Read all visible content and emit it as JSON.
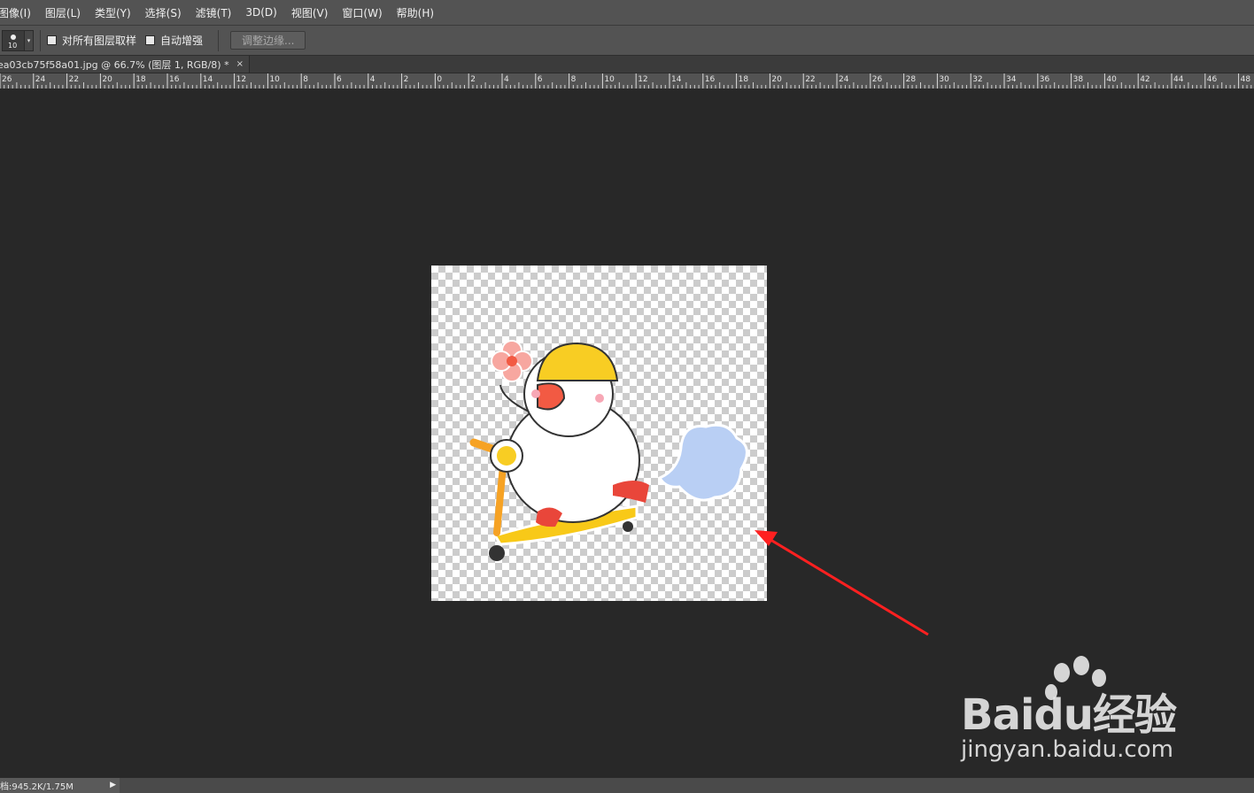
{
  "menubar": {
    "items": [
      "图像(I)",
      "图层(L)",
      "类型(Y)",
      "选择(S)",
      "滤镜(T)",
      "3D(D)",
      "视图(V)",
      "窗口(W)",
      "帮助(H)"
    ]
  },
  "options": {
    "brush_size": "10",
    "sample_all_layers_label": "对所有图层取样",
    "auto_enhance_label": "自动增强",
    "refine_edge_label": "调整边缘..."
  },
  "document_tab": {
    "title": "ea03cb75f58a01.jpg @ 66.7% (图层 1, RGB/8) *",
    "close_glyph": "×"
  },
  "ruler": {
    "unit_labels": [
      "26",
      "24",
      "22",
      "20",
      "18",
      "16",
      "14",
      "12",
      "10",
      "8",
      "6",
      "4",
      "2",
      "0",
      "2",
      "4",
      "6",
      "8",
      "10",
      "12",
      "14",
      "16",
      "18",
      "20",
      "22",
      "24",
      "26",
      "28",
      "30",
      "32",
      "34",
      "36",
      "38",
      "40",
      "42",
      "44",
      "46",
      "48"
    ]
  },
  "watermark": {
    "logo_text": "Baidu经验",
    "url_text": "jingyan.baidu.com"
  },
  "status": {
    "doc_size": "档:945.2K/1.75M",
    "arrow_glyph": "▶"
  },
  "colors": {
    "panel": "#535353",
    "canvas_bg": "#282828",
    "annotation_arrow": "#ff2020"
  }
}
